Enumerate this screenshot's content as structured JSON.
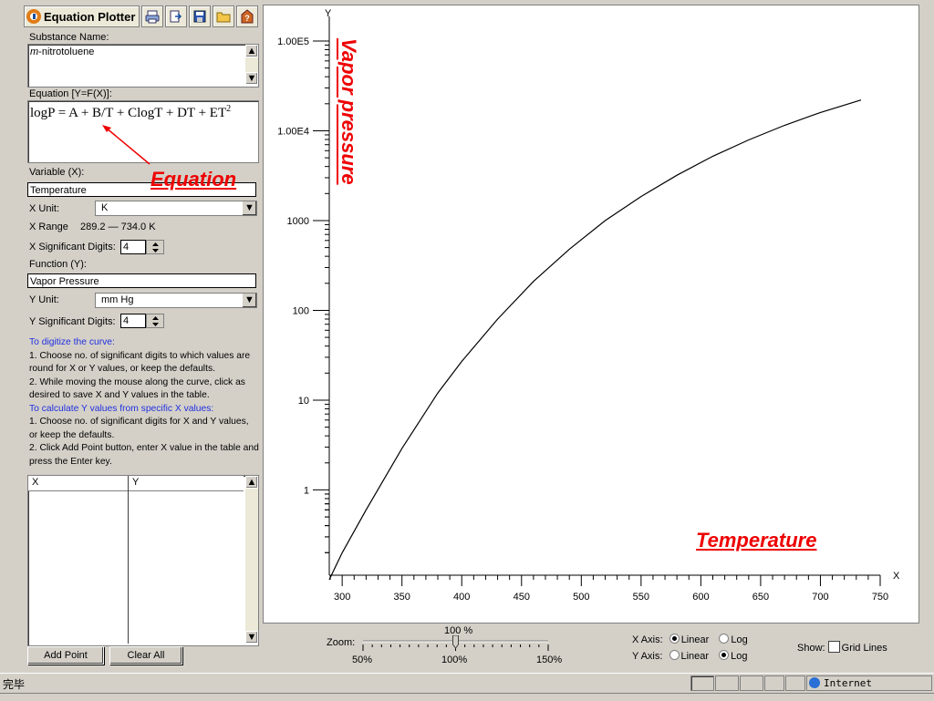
{
  "app": {
    "title": "Equation Plotter"
  },
  "toolbar": {
    "icons": [
      "print-icon",
      "export-icon",
      "save-icon",
      "open-folder-icon",
      "help-icon"
    ]
  },
  "substance": {
    "label": "Substance Name:",
    "prefix": "m",
    "name": "-nitrotoluene"
  },
  "equation": {
    "label": "Equation [Y=F(X)]:",
    "text": "logP = A + B/T + ClogT + DT + ET",
    "sup": "2"
  },
  "variable": {
    "label": "Variable (X):",
    "value": "Temperature"
  },
  "x_unit": {
    "label": "X Unit:",
    "value": "K"
  },
  "x_range": {
    "label": "X Range",
    "value": "289.2 — 734.0 K"
  },
  "x_sig": {
    "label": "X Significant Digits:",
    "value": "4"
  },
  "function": {
    "label": "Function (Y):",
    "value": "Vapor Pressure"
  },
  "y_unit": {
    "label": "Y Unit:",
    "value": "mm Hg"
  },
  "y_sig": {
    "label": "Y Significant Digits:",
    "value": "4"
  },
  "instructions": {
    "h1": "To digitize the curve:",
    "p1": "1. Choose no. of significant digits to which values are round for X or Y values, or keep the defaults.",
    "p2": "2. While moving the mouse along the curve, click as desired to save X and Y values in the table.",
    "h2": "To calculate Y values from specific X values:",
    "p3": "1. Choose no. of significant digits for X and Y values, or keep the defaults.",
    "p4": "2. Click Add Point button, enter X value in the table and press the Enter key."
  },
  "table": {
    "col_x": "X",
    "col_y": "Y"
  },
  "buttons": {
    "add_point": "Add Point",
    "clear_all": "Clear All"
  },
  "annotations": {
    "equation": "Equation",
    "vapor_pressure": "Vapor pressure",
    "temperature": "Temperature"
  },
  "zoom": {
    "label": "Zoom:",
    "value": "100 %",
    "min": "50%",
    "mid": "100%",
    "max": "150%",
    "level": 100
  },
  "axes_controls": {
    "x_label": "X Axis:",
    "y_label": "Y Axis:",
    "linear": "Linear",
    "log": "Log",
    "x_selected": "Linear",
    "y_selected": "Log",
    "show_label": "Show:",
    "grid_lines": "Grid Lines"
  },
  "statusbar": {
    "text": "完毕",
    "zone": "Internet"
  },
  "chart_data": {
    "type": "line",
    "x_axis_name": "X",
    "y_axis_name": "Y",
    "x_scale": "linear",
    "y_scale": "log",
    "xlim": [
      289.2,
      750
    ],
    "ylim": [
      0.1,
      100000
    ],
    "x_ticks": [
      300,
      350,
      400,
      450,
      500,
      550,
      600,
      650,
      700,
      750
    ],
    "y_ticks": [
      1,
      10,
      100,
      1000,
      10000,
      100000
    ],
    "y_tick_labels": [
      "1",
      "10",
      "100",
      "1000",
      "1.00E4",
      "1.00E5"
    ],
    "grid": false,
    "series": [
      {
        "x": [
          289.2,
          300,
          320,
          350,
          380,
          400,
          430,
          460,
          490,
          520,
          550,
          580,
          610,
          640,
          670,
          700,
          734
        ],
        "y": [
          0.1,
          0.2,
          0.6,
          2.9,
          12,
          27,
          80,
          210,
          480,
          1000,
          1850,
          3200,
          5200,
          7900,
          11500,
          16000,
          22000
        ]
      }
    ]
  }
}
